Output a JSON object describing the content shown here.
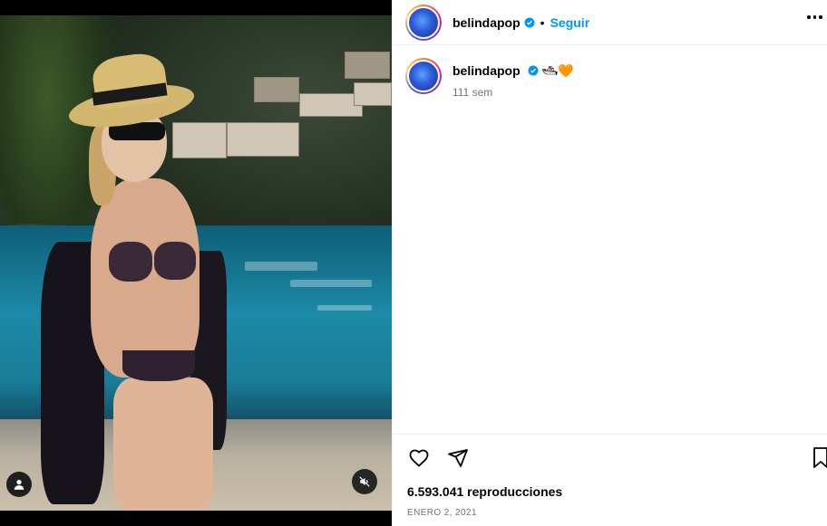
{
  "post": {
    "username": "belindapop",
    "follow_label": "Seguir",
    "separator": "•",
    "caption_emoji": "🛥🧡",
    "time_ago": "111 sem",
    "views": "6.593.041 reproducciones",
    "date": "ENERO 2, 2021"
  },
  "icons": {
    "verified": "verified-badge-icon",
    "more": "more-options-icon",
    "like": "heart-icon",
    "share": "share-icon",
    "save": "bookmark-icon",
    "tag": "tagged-user-icon",
    "mute": "muted-audio-icon"
  },
  "colors": {
    "accent": "#0095f6",
    "secondary_text": "#737373",
    "divider": "#efefef"
  }
}
